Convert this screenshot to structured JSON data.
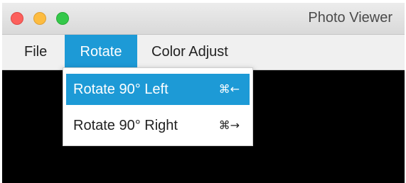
{
  "window": {
    "title": "Photo Viewer"
  },
  "menubar": {
    "items": [
      {
        "label": "File"
      },
      {
        "label": "Rotate"
      },
      {
        "label": "Color Adjust"
      }
    ]
  },
  "rotate_menu": {
    "items": [
      {
        "label": "Rotate 90° Left",
        "shortcut": "⌘←"
      },
      {
        "label": "Rotate 90° Right",
        "shortcut": "⌘→"
      }
    ]
  },
  "colors": {
    "accent": "#1d9ad6",
    "canvas": "#000000",
    "close": "#fc605c",
    "minimize": "#fdbc40",
    "maximize": "#34c84a"
  }
}
